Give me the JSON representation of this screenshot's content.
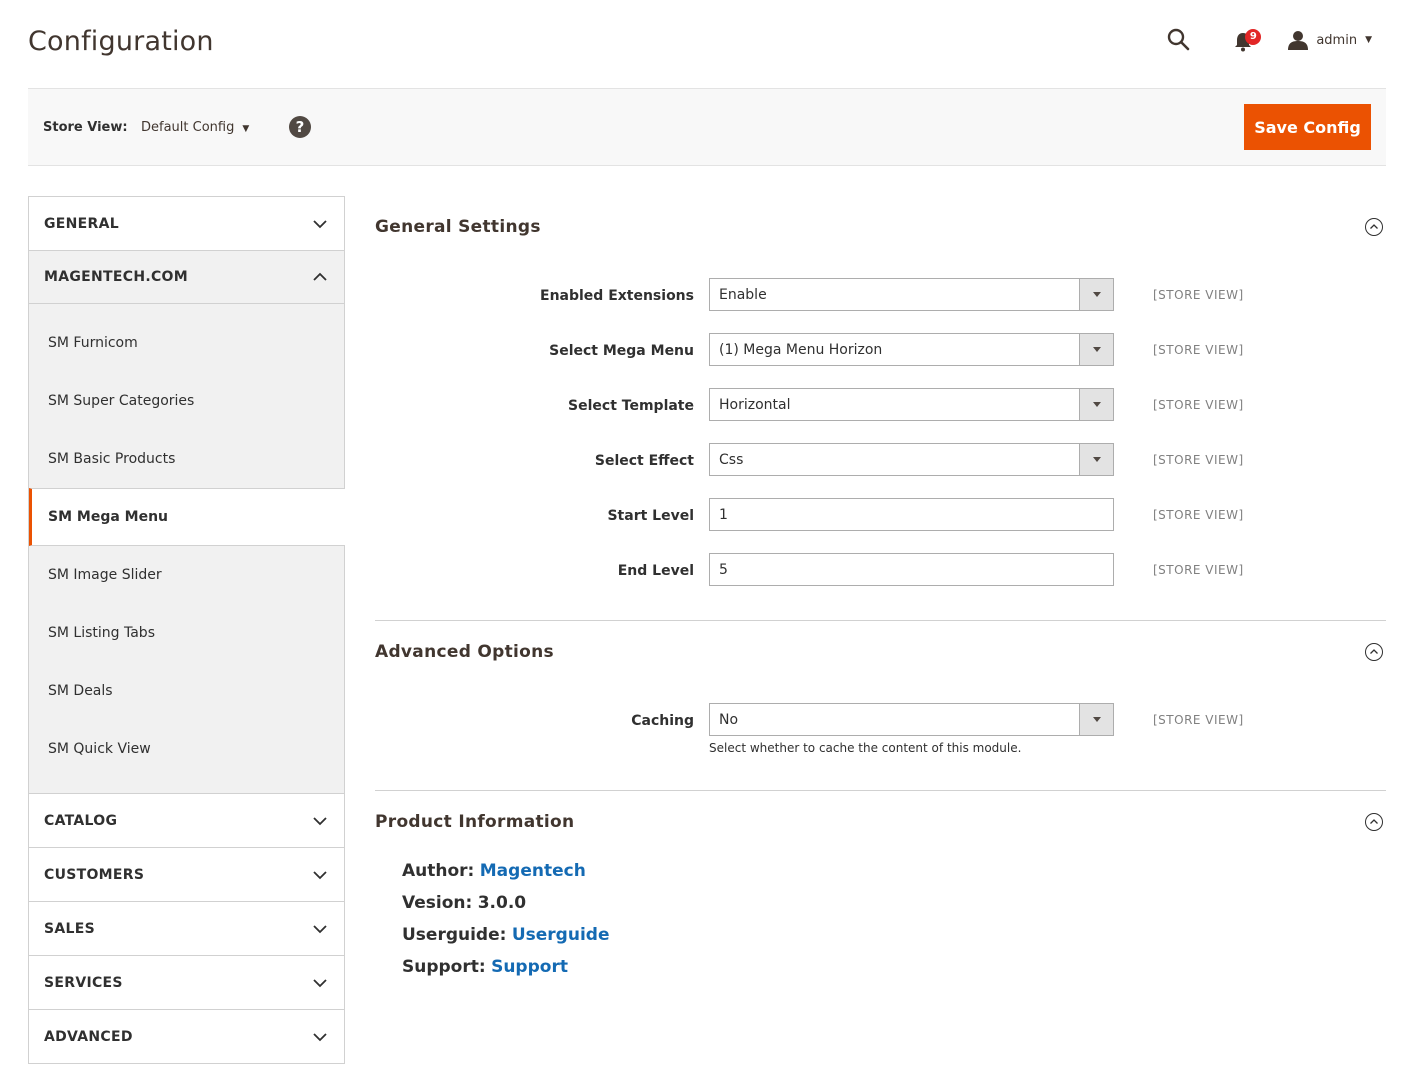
{
  "header": {
    "title": "Configuration",
    "notification_count": "9",
    "user_name": "admin"
  },
  "store_bar": {
    "label": "Store View:",
    "selected": "Default Config",
    "help": "?",
    "save_label": "Save Config"
  },
  "sidebar": {
    "groups": [
      {
        "title": "GENERAL"
      },
      {
        "title": "MAGENTECH.COM",
        "items": [
          "SM Furnicom",
          "SM Super Categories",
          "SM Basic Products",
          "SM Mega Menu",
          "SM Image Slider",
          "SM Listing Tabs",
          "SM Deals",
          "SM Quick View"
        ]
      },
      {
        "title": "CATALOG"
      },
      {
        "title": "CUSTOMERS"
      },
      {
        "title": "SALES"
      },
      {
        "title": "SERVICES"
      },
      {
        "title": "ADVANCED"
      }
    ]
  },
  "general_settings": {
    "title": "General Settings",
    "fields": [
      {
        "label": "Enabled Extensions",
        "value": "Enable",
        "scope": "[STORE VIEW]"
      },
      {
        "label": "Select Mega Menu",
        "value": "(1) Mega Menu Horizon",
        "scope": "[STORE VIEW]"
      },
      {
        "label": "Select Template",
        "value": "Horizontal",
        "scope": "[STORE VIEW]"
      },
      {
        "label": "Select Effect",
        "value": "Css",
        "scope": "[STORE VIEW]"
      },
      {
        "label": "Start Level",
        "value": "1",
        "scope": "[STORE VIEW]"
      },
      {
        "label": "End Level",
        "value": "5",
        "scope": "[STORE VIEW]"
      }
    ]
  },
  "advanced_options": {
    "title": "Advanced Options",
    "caching": {
      "label": "Caching",
      "value": "No",
      "scope": "[STORE VIEW]",
      "note": "Select whether to cache the content of this module."
    }
  },
  "product_info": {
    "title": "Product Information",
    "author_key": "Author:",
    "author_val": "Magentech",
    "version_key": "Vesion:",
    "version_val": "3.0.0",
    "guide_key": "Userguide:",
    "guide_val": "Userguide",
    "support_key": "Support:",
    "support_val": "Support"
  },
  "colors": {
    "accent": "#eb5202",
    "link": "#146ab3",
    "badge": "#e22626"
  }
}
